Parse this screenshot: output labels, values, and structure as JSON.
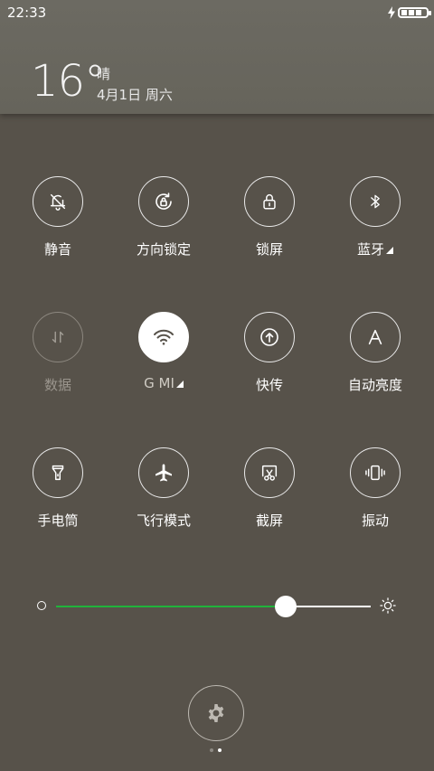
{
  "status_bar": {
    "time": "22:33"
  },
  "weather": {
    "temperature": "16°",
    "condition": "晴",
    "date": "4月1日 周六"
  },
  "toggles": [
    {
      "label": "静音",
      "icon": "bell-off-icon"
    },
    {
      "label": "方向锁定",
      "icon": "rotation-lock-icon"
    },
    {
      "label": "锁屏",
      "icon": "lock-icon"
    },
    {
      "label": "蓝牙",
      "icon": "bluetooth-icon"
    },
    {
      "label": "数据",
      "icon": "mobile-data-icon"
    },
    {
      "label": "G  MI",
      "icon": "wifi-icon"
    },
    {
      "label": "快传",
      "icon": "quick-transfer-icon"
    },
    {
      "label": "自动亮度",
      "icon": "auto-brightness-icon"
    },
    {
      "label": "手电筒",
      "icon": "flashlight-icon"
    },
    {
      "label": "飞行模式",
      "icon": "airplane-icon"
    },
    {
      "label": "截屏",
      "icon": "screenshot-icon"
    },
    {
      "label": "振动",
      "icon": "vibrate-icon"
    }
  ],
  "brightness": {
    "level": 0.73,
    "fill_color": "#20b33b"
  },
  "pager": {
    "pages": 2,
    "current": 2
  }
}
